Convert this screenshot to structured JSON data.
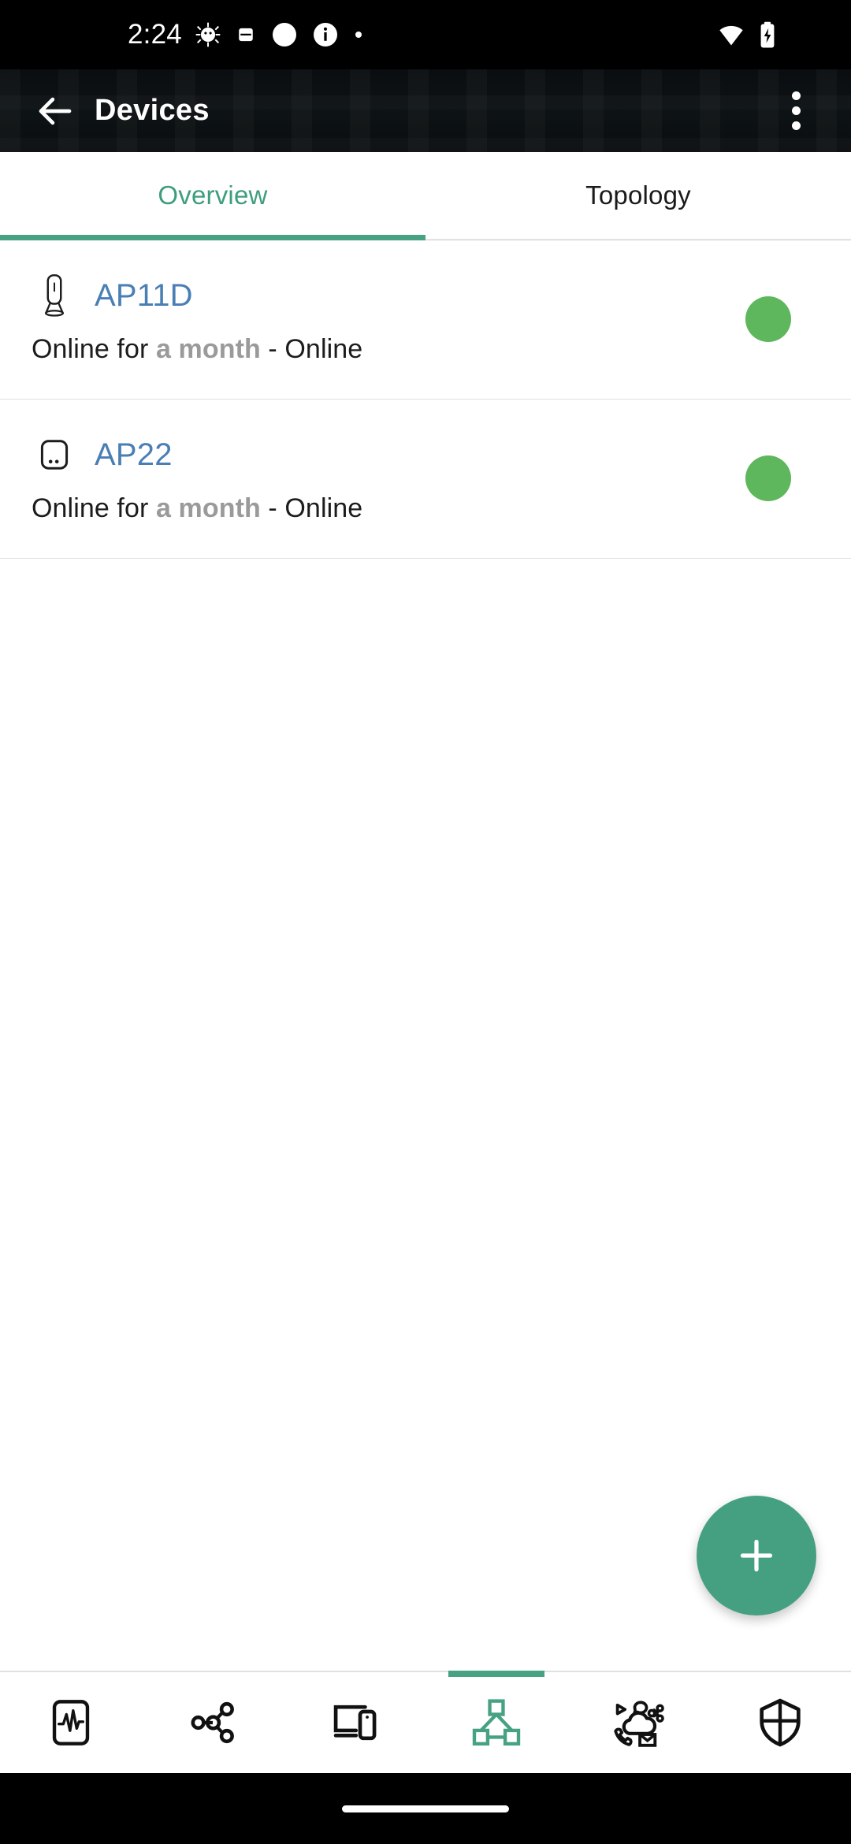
{
  "status_bar": {
    "clock": "2:24",
    "left_icons": [
      "android-bug-icon",
      "battery-saver-icon",
      "sync-icon",
      "info-icon",
      "dot-icon"
    ],
    "right_icons": [
      "wifi-icon",
      "battery-charging-icon"
    ]
  },
  "app_bar": {
    "back_icon": "back-arrow-icon",
    "title": "Devices",
    "overflow_icon": "overflow-menu-icon"
  },
  "tabs": [
    {
      "label": "Overview",
      "active": true
    },
    {
      "label": "Topology",
      "active": false
    }
  ],
  "devices": [
    {
      "name": "AP11D",
      "icon": "router-upright-icon",
      "status_prefix": "Online for ",
      "status_duration": "a month",
      "status_suffix": " - Online",
      "indicator_color": "#5eb75c"
    },
    {
      "name": "AP22",
      "icon": "access-point-box-icon",
      "status_prefix": "Online for ",
      "status_duration": "a month",
      "status_suffix": " - Online",
      "indicator_color": "#5eb75c"
    }
  ],
  "fab": {
    "icon": "plus-icon",
    "label": "+",
    "color": "#45a081"
  },
  "bottom_nav": [
    {
      "name": "monitoring",
      "icon": "pulse-monitor-icon",
      "active": false
    },
    {
      "name": "network",
      "icon": "network-nodes-icon",
      "active": false
    },
    {
      "name": "clients",
      "icon": "devices-monitor-phone-icon",
      "active": false
    },
    {
      "name": "topology",
      "icon": "topology-hierarchy-icon",
      "active": true
    },
    {
      "name": "services",
      "icon": "cloud-services-icon",
      "active": false
    },
    {
      "name": "security",
      "icon": "shield-icon",
      "active": false
    }
  ],
  "theme": {
    "accent_green": "#47a183",
    "tab_active_text": "#3e9e7c",
    "device_name_blue": "#4a7fb5",
    "status_dot_green": "#5eb75c",
    "app_bar_bg": "#0c1012"
  },
  "gesture_bar": {
    "icon": "home-gesture-pill"
  }
}
